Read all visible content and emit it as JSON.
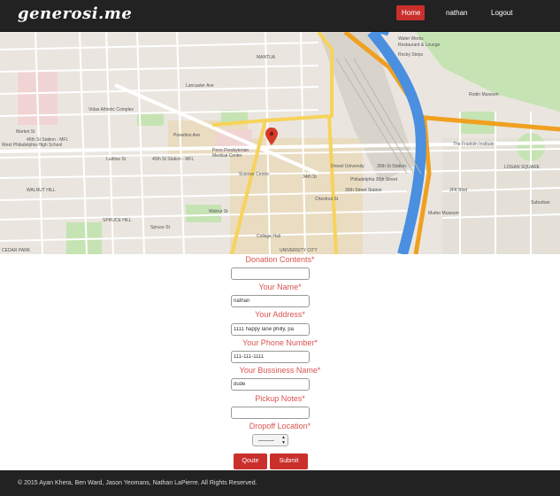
{
  "navbar": {
    "brand": "generosi.me",
    "items": [
      {
        "label": "Home"
      },
      {
        "label": "nathan"
      },
      {
        "label": "Logout"
      }
    ]
  },
  "map": {
    "labels": {
      "mantua": "MANTUA",
      "water_works": "Water Works",
      "water_works_sub": "Restaurant & Lounge",
      "rocky_steps": "Rocky Steps",
      "rodin": "Rodin Museum",
      "franklin": "The Franklin Institute",
      "logan": "LOGAN SQUARE",
      "suburban": "Suburban",
      "vidas": "Vidas Athletic Complex",
      "penn_presby": "Penn Presbyterian",
      "penn_presby_sub": "Medical Center",
      "drexel": "Drexel University",
      "station30": "30th St Station",
      "phila30": "Philadelphia 30th Street",
      "science_center": "Science Center",
      "station34": "34th St",
      "station30b": "30th Street Station",
      "kennedy": "JFK Blvd",
      "mutter": "Mutter Museum",
      "college_hall": "College Hall",
      "university_city": "UNIVERSITY CITY",
      "walnut_hill": "WALNUT HILL",
      "spruce_hill": "SPRUCE HILL",
      "cedar_park": "CEDAR PARK",
      "station46": "46th St Station - MFL",
      "station40": "40th St Station - MFL",
      "west_phila_hs": "West Philadelphia High School",
      "market_st": "Market St",
      "lancaster": "Lancaster Ave",
      "powelton": "Powelton Ave",
      "spruce_st": "Spruce St",
      "chestnut": "Chestnut St",
      "walnut_st": "Walnut St",
      "ludlow": "Ludlow St"
    },
    "pin_color": "#d23b2a"
  },
  "form": {
    "donation_contents_label": "Donation Contents*",
    "donation_contents_value": "",
    "name_label": "Your Name*",
    "name_value": "nathan",
    "address_label": "Your Address*",
    "address_value": "1111 happy lane philly, pa",
    "phone_label": "Your Phone Number*",
    "phone_value": "111-111-1111",
    "business_label": "Your Bussiness Name*",
    "business_value": "dude",
    "pickup_label": "Pickup Notes*",
    "pickup_value": "",
    "dropoff_label": "Dropoff Location*",
    "quote_label": "Qoute",
    "submit_label": "Submit"
  },
  "footer": {
    "text": "© 2015 Ayan Khera, Ben Ward, Jason Yeomans, Nathan LaPierre. All Rights Reserved."
  },
  "colors": {
    "navbar_bg": "#222222",
    "accent": "#c9302c",
    "label_red": "#d9534f",
    "map_base": "#eae6df",
    "river": "#4a8fe0",
    "highway": "#f0a020",
    "main_road": "#f7d35a",
    "park": "#c6e3b4"
  }
}
